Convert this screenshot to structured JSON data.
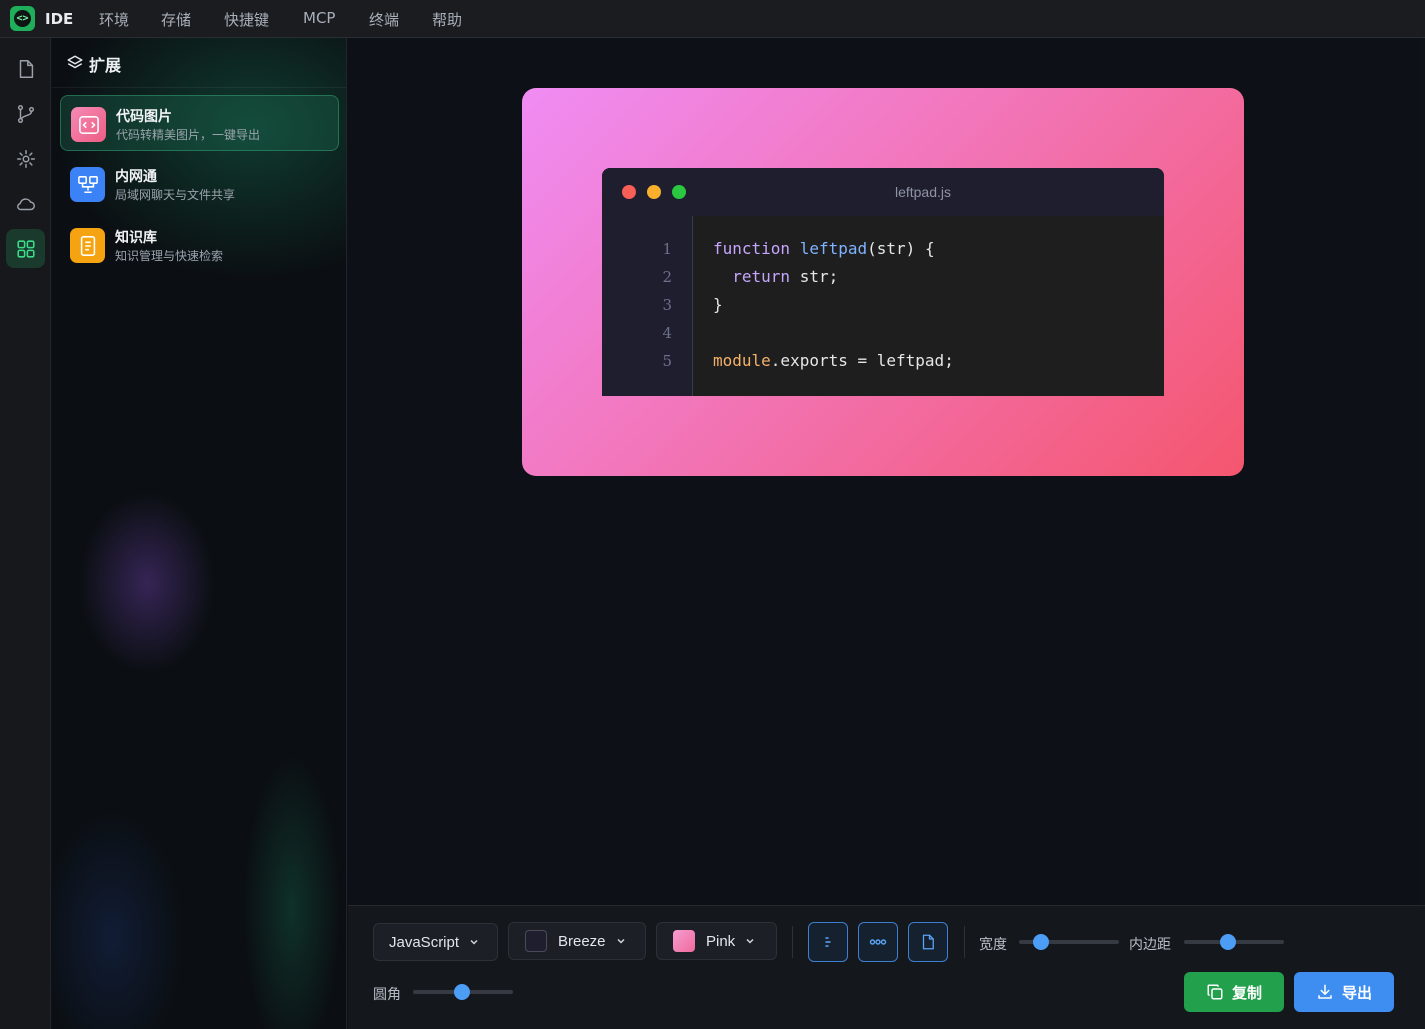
{
  "app": {
    "name": "IDE",
    "logo_glyph": "<>"
  },
  "menu": [
    "环境",
    "存储",
    "快捷键",
    "MCP",
    "终端",
    "帮助"
  ],
  "activity_bar": [
    {
      "icon": "file-icon",
      "active": false
    },
    {
      "icon": "git-branch-icon",
      "active": false
    },
    {
      "icon": "sun-icon",
      "active": false
    },
    {
      "icon": "cloud-icon",
      "active": false
    },
    {
      "icon": "extensions-grid-icon",
      "active": true
    }
  ],
  "sidebar": {
    "title": "扩展",
    "items": [
      {
        "name": "代码图片",
        "desc": "代码转精美图片，一键导出",
        "icon": "code-image-icon",
        "color": "#f06a96",
        "active": true
      },
      {
        "name": "内网通",
        "desc": "局域网聊天与文件共享",
        "icon": "network-icon",
        "color": "#3b82f6",
        "active": false
      },
      {
        "name": "知识库",
        "desc": "知识管理与快速检索",
        "icon": "book-icon",
        "color": "#f5a311",
        "active": false
      }
    ]
  },
  "preview": {
    "filename": "leftpad.js",
    "line_numbers": [
      "1",
      "2",
      "3",
      "4",
      "5"
    ],
    "code": [
      "function leftpad(str) {",
      "  return str;",
      "}",
      "",
      "module.exports = leftpad;"
    ],
    "background_colors": [
      "#f08cf4",
      "#f4566e"
    ],
    "traffic_lights": [
      "#f75f57",
      "#f8b02c",
      "#2ac840"
    ]
  },
  "toolbar": {
    "language": "JavaScript",
    "theme": {
      "label": "Breeze",
      "color": "#1f1e2e"
    },
    "background": {
      "label": "Pink",
      "color": "#f278b6"
    },
    "toggles": [
      "line-numbers-icon",
      "window-dots-icon",
      "filename-icon"
    ],
    "width_label": "宽度",
    "width_value": 0.22,
    "padding_label": "内边距",
    "padding_value": 0.44,
    "radius_label": "圆角",
    "radius_value": 0.49,
    "copy_label": "复制",
    "export_label": "导出"
  }
}
